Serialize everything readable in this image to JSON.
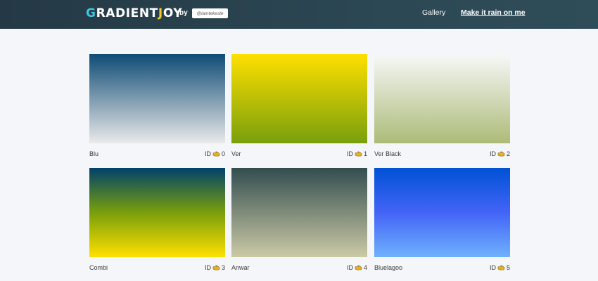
{
  "header": {
    "logo_first": "G",
    "logo_mid": "RADIENT",
    "logo_j": "J",
    "logo_end": "OY",
    "by": "by",
    "handle": "@iamtekeste",
    "nav_gallery": "Gallery",
    "nav_rain": "Make it rain on me",
    "colors": {
      "bg": "#2b4753",
      "accent_g": "#3fc7e0",
      "accent_j": "#f3c623"
    }
  },
  "gradients": [
    {
      "name": "Blu",
      "id_label": "ID",
      "id": "0",
      "from": "#0f4c75",
      "to": "#eaeaea"
    },
    {
      "name": "Ver",
      "id_label": "ID",
      "id": "1",
      "from": "#ffe000",
      "to": "#799f0c"
    },
    {
      "name": "Ver Black",
      "id_label": "ID",
      "id": "2",
      "from": "#f7f8f8",
      "to": "#acbb78"
    },
    {
      "name": "Combi",
      "id_label": "ID",
      "id": "3",
      "from": "#00416a",
      "mid": "#799f0c",
      "to": "#ffe000"
    },
    {
      "name": "Anwar",
      "id_label": "ID",
      "id": "4",
      "from": "#334d50",
      "to": "#cbcaa5"
    },
    {
      "name": "Bluelagoo",
      "id_label": "ID",
      "id": "5",
      "from": "#0052d4",
      "mid": "#4364f7",
      "to": "#6fb1fc"
    }
  ],
  "icons": {
    "id_hand": "pointing-hand-icon"
  }
}
